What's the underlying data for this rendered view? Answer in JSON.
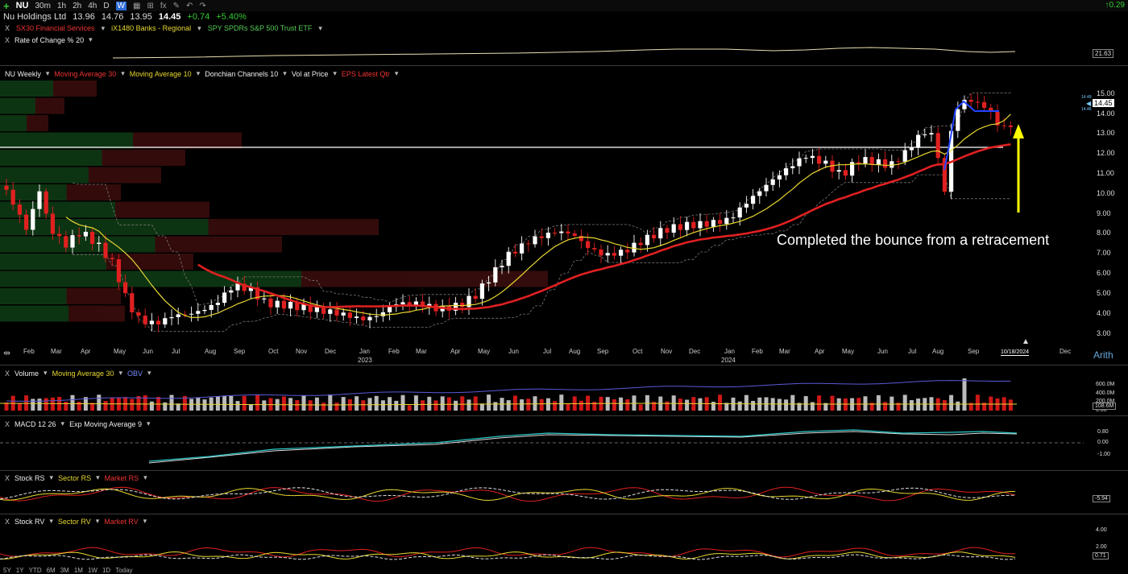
{
  "toolbar": {
    "symbol": "NU",
    "timeframes": [
      "30m",
      "1h",
      "2h",
      "4h",
      "D",
      "W"
    ],
    "active_timeframe": "W",
    "right_value": "0.29"
  },
  "quote": {
    "name": "Nu Holdings Ltd",
    "open": "13.96",
    "high": "14.76",
    "low": "13.95",
    "last": "14.45",
    "change": "+0.74",
    "change_pct": "+5.40%"
  },
  "compare": {
    "items": [
      {
        "label": "SX30 Financial Services"
      },
      {
        "label": "iX1480 Banks - Regional"
      },
      {
        "label": "SPY SPDRs S&P 500 Trust ETF"
      }
    ]
  },
  "roc": {
    "label": "Rate of Change % 20",
    "value": "21.63"
  },
  "main": {
    "title": "NU Weekly",
    "indicators": [
      "Moving Average 30",
      "Moving Average 10",
      "Donchian Channels 10",
      "Vol at Price",
      "EPS Latest Qtr"
    ],
    "price_labels": [
      "15.00",
      "14.00",
      "13.00",
      "12.00",
      "11.00",
      "10.00",
      "9.00",
      "8.00",
      "7.00",
      "6.00",
      "5.00",
      "4.00",
      "3.00"
    ],
    "last_price": "14.45",
    "mini_tags": [
      "14.49",
      "14.46"
    ],
    "scale": "Arith",
    "date_tag": "10/18/2024",
    "annotation": "Completed the bounce from a retracement",
    "months": [
      "Feb",
      "Mar",
      "Apr",
      "May",
      "Jun",
      "Jul",
      "Aug",
      "Sep",
      "Oct",
      "Nov",
      "Dec",
      "Jan",
      "Feb",
      "Mar",
      "Apr",
      "May",
      "Jun",
      "Jul",
      "Aug",
      "Sep",
      "Oct",
      "Nov",
      "Dec",
      "Jan",
      "Feb",
      "Mar",
      "Apr",
      "May",
      "Jun",
      "Jul",
      "Aug",
      "Sep",
      "Dec"
    ],
    "years": [
      "2023",
      "2024"
    ]
  },
  "volume": {
    "labels": [
      "Volume",
      "Moving Average 30",
      "OBV"
    ],
    "ticks": [
      "600.0M",
      "400.0M",
      "200.0M",
      "0.00"
    ],
    "value_tag": "108.6M"
  },
  "macd": {
    "labels": [
      "MACD 12 26",
      "Exp Moving Average 9"
    ],
    "ticks": [
      "0.80",
      "0.00",
      "-1.00"
    ]
  },
  "stock_rs": {
    "labels": [
      "Stock RS",
      "Sector RS",
      "Market RS"
    ],
    "value_tag": "-5.94"
  },
  "stock_rv": {
    "labels": [
      "Stock RV",
      "Sector RV",
      "Market RV"
    ],
    "ticks": [
      "4.00",
      "2.00"
    ],
    "value_tag": "0.71"
  },
  "bottom": {
    "ranges": [
      "5Y",
      "1Y",
      "YTD",
      "6M",
      "3M",
      "1M",
      "1W",
      "1D",
      "Today"
    ]
  },
  "colors": {
    "up": "#ffffff",
    "down": "#e02020",
    "ma10": "#e8d830",
    "ma30": "#e02020",
    "arrow": "#ffff00"
  }
}
